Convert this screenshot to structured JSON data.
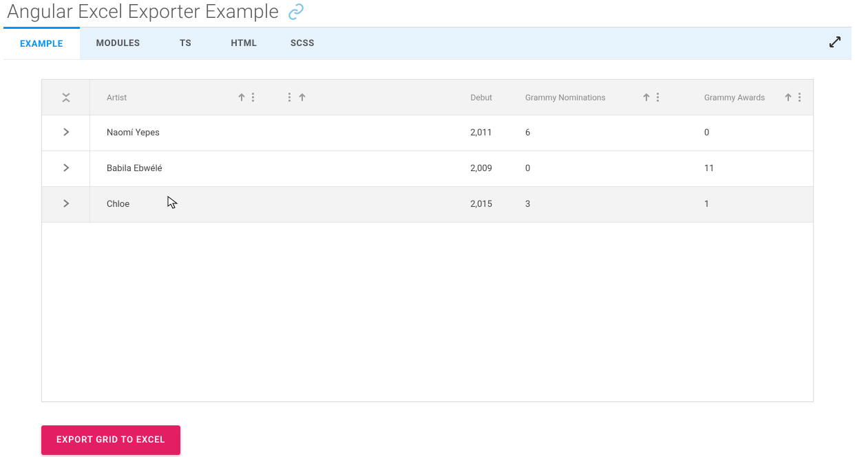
{
  "header": {
    "title": "Angular Excel Exporter Example"
  },
  "tabs": [
    {
      "label": "EXAMPLE",
      "active": true
    },
    {
      "label": "MODULES",
      "active": false
    },
    {
      "label": "TS",
      "active": false
    },
    {
      "label": "HTML",
      "active": false
    },
    {
      "label": "SCSS",
      "active": false
    }
  ],
  "grid": {
    "columns": {
      "artist": "Artist",
      "debut": "Debut",
      "grammy_nominations": "Grammy Nominations",
      "grammy_awards": "Grammy Awards"
    },
    "rows": [
      {
        "artist": "Naomí Yepes",
        "debut": "2,011",
        "nominations": "6",
        "awards": "0",
        "hovered": false
      },
      {
        "artist": "Babila Ebwélé",
        "debut": "2,009",
        "nominations": "0",
        "awards": "11",
        "hovered": false
      },
      {
        "artist": "Chloe",
        "debut": "2,015",
        "nominations": "3",
        "awards": "1",
        "hovered": true
      }
    ]
  },
  "actions": {
    "export_label": "EXPORT GRID TO EXCEL"
  },
  "colors": {
    "accent": "#0094ff",
    "tab_bg": "#e6f3fd",
    "export_btn": "#e41e62"
  }
}
